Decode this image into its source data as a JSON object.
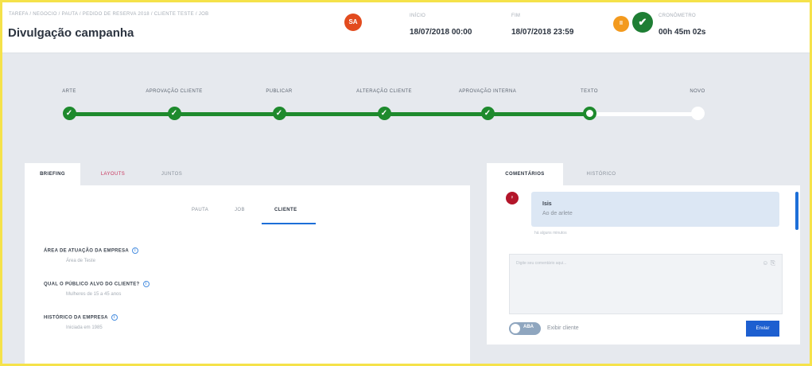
{
  "header": {
    "breadcrumb": "TAREFA / NEGOCIO / PAUTA / PEDIDO DE RESERVA 2018 / CLIENTE TESTE / JOB",
    "title": "Divulgação campanha",
    "avatar_initials": "SA",
    "start_label": "INÍCIO",
    "start_value": "18/07/2018 00:00",
    "end_label": "FIM",
    "end_value": "18/07/2018 23:59",
    "pause_label": "II",
    "timer_label": "CRONÔMETRO",
    "timer_value": "00h 45m 02s"
  },
  "stepper": {
    "steps": [
      {
        "label": "ARTE",
        "state": "done"
      },
      {
        "label": "APROVAÇÃO CLIENTE",
        "state": "done"
      },
      {
        "label": "PUBLICAR",
        "state": "done"
      },
      {
        "label": "ALTERAÇÃO CLIENTE",
        "state": "done"
      },
      {
        "label": "APROVAÇÃO INTERNA",
        "state": "done"
      },
      {
        "label": "TEXTO",
        "state": "current"
      },
      {
        "label": "NOVO",
        "state": "pending"
      }
    ]
  },
  "left_tabs": [
    "BRIEFING",
    "LAYOUTS",
    "JUNTOS"
  ],
  "sub_tabs": [
    "PAUTA",
    "JOB",
    "CLIENTE"
  ],
  "fields": [
    {
      "label": "ÁREA DE ATUAÇÃO DA EMPRESA",
      "value": "Área de Teste"
    },
    {
      "label": "QUAL O PÚBLICO ALVO DO CLIENTE?",
      "value": "Mulheres de 15 a 45 anos"
    },
    {
      "label": "HISTÓRICO DA EMPRESA",
      "value": "Iniciada em 1985"
    }
  ],
  "right_tabs": [
    "COMENTÁRIOS",
    "HISTÓRICO"
  ],
  "comment": {
    "avatar": "♀",
    "author": "Isis",
    "text": "Ao de arlete",
    "time": "há alguns minutos"
  },
  "composer": {
    "placeholder": "Digite seu comentário aqui...",
    "toggle_text": "ABA",
    "toggle_label": "Exibir cliente",
    "send_label": "Enviar"
  },
  "colors": {
    "accent_green": "#1e8a2d",
    "accent_blue": "#1d6fd8",
    "avatar_red": "#e24b1e",
    "pause_orange": "#f39a1e",
    "frame_yellow": "#f5e24a"
  }
}
